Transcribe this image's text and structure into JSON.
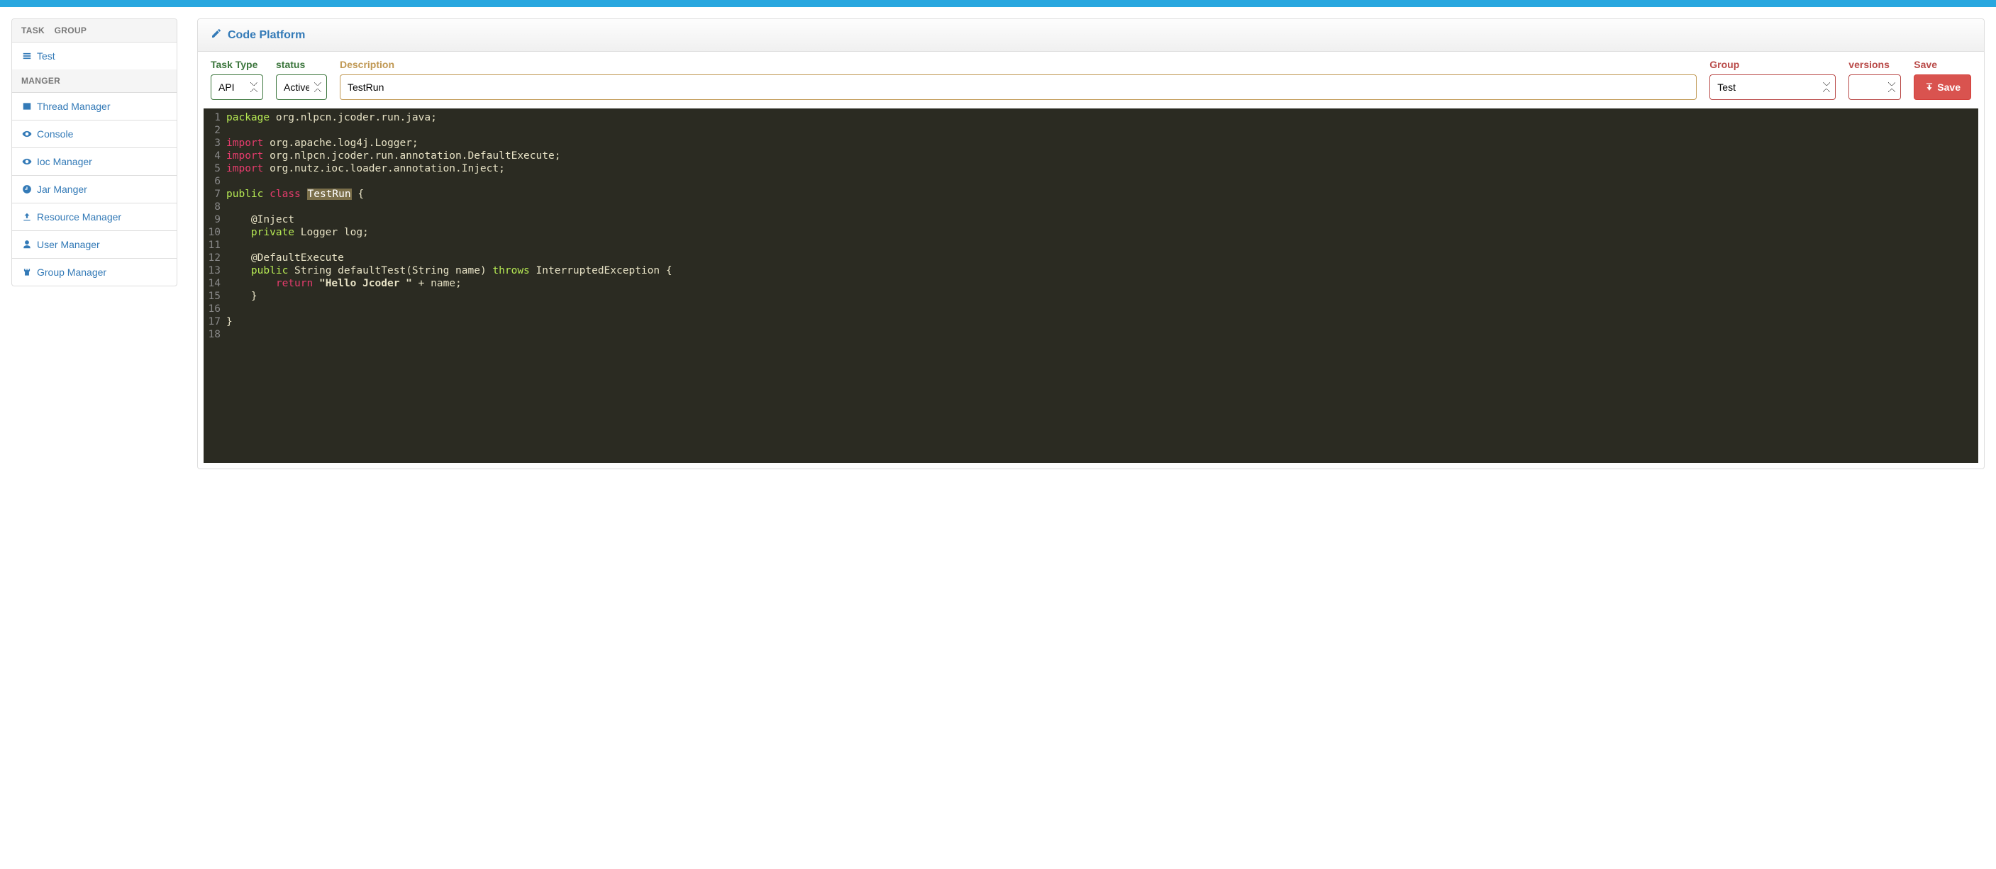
{
  "sidebar": {
    "headers": {
      "task": "TASK",
      "group": "GROUP",
      "manger": "MANGER"
    },
    "task_items": [
      {
        "id": "test",
        "label": "Test",
        "icon": "tasks-icon"
      }
    ],
    "manger_items": [
      {
        "id": "thread-manager",
        "label": "Thread Manager",
        "icon": "list-alt-icon"
      },
      {
        "id": "console",
        "label": "Console",
        "icon": "eye-icon"
      },
      {
        "id": "ioc-manager",
        "label": "Ioc Manager",
        "icon": "eye-icon"
      },
      {
        "id": "jar-manger",
        "label": "Jar Manger",
        "icon": "clock-icon"
      },
      {
        "id": "resource-manager",
        "label": "Resource Manager",
        "icon": "upload-icon"
      },
      {
        "id": "user-manager",
        "label": "User Manager",
        "icon": "user-icon"
      },
      {
        "id": "group-manager",
        "label": "Group Manager",
        "icon": "tower-icon"
      }
    ]
  },
  "header": {
    "title": "Code Platform"
  },
  "form": {
    "task_type": {
      "label": "Task Type",
      "value": "API",
      "options": [
        "API"
      ]
    },
    "status": {
      "label": "status",
      "value": "Active",
      "options": [
        "Active"
      ]
    },
    "description": {
      "label": "Description",
      "value": "TestRun"
    },
    "group": {
      "label": "Group",
      "value": "Test",
      "options": [
        "Test"
      ]
    },
    "versions": {
      "label": "versions",
      "value": "",
      "options": []
    },
    "save": {
      "label": "Save",
      "button": "Save"
    }
  },
  "code": {
    "lines": [
      {
        "n": 1,
        "segments": [
          {
            "t": "package",
            "c": "kw"
          },
          {
            "t": " ",
            "c": "punc"
          },
          {
            "t": "org.nlpcn.jcoder.run.java",
            "c": "type"
          },
          {
            "t": ";",
            "c": "punc"
          }
        ]
      },
      {
        "n": 2,
        "segments": []
      },
      {
        "n": 3,
        "segments": [
          {
            "t": "import",
            "c": "kw2"
          },
          {
            "t": " ",
            "c": "punc"
          },
          {
            "t": "org.apache.log4j.Logger",
            "c": "type"
          },
          {
            "t": ";",
            "c": "punc"
          }
        ]
      },
      {
        "n": 4,
        "segments": [
          {
            "t": "import",
            "c": "kw2"
          },
          {
            "t": " ",
            "c": "punc"
          },
          {
            "t": "org.nlpcn.jcoder.run.annotation.DefaultExecute",
            "c": "type"
          },
          {
            "t": ";",
            "c": "punc"
          }
        ]
      },
      {
        "n": 5,
        "segments": [
          {
            "t": "import",
            "c": "kw2"
          },
          {
            "t": " ",
            "c": "punc"
          },
          {
            "t": "org.nutz.ioc.loader.annotation.Inject",
            "c": "type"
          },
          {
            "t": ";",
            "c": "punc"
          }
        ]
      },
      {
        "n": 6,
        "segments": []
      },
      {
        "n": 7,
        "segments": [
          {
            "t": "public",
            "c": "kw"
          },
          {
            "t": " ",
            "c": "punc"
          },
          {
            "t": "class",
            "c": "kw2"
          },
          {
            "t": " ",
            "c": "punc"
          },
          {
            "t": "TestRun",
            "c": "hl"
          },
          {
            "t": " {",
            "c": "punc"
          }
        ]
      },
      {
        "n": 8,
        "segments": []
      },
      {
        "n": 9,
        "segments": [
          {
            "t": "    @Inject",
            "c": "ann"
          }
        ]
      },
      {
        "n": 10,
        "segments": [
          {
            "t": "    ",
            "c": "punc"
          },
          {
            "t": "private",
            "c": "kw"
          },
          {
            "t": " Logger log;",
            "c": "type"
          }
        ]
      },
      {
        "n": 11,
        "segments": []
      },
      {
        "n": 12,
        "segments": [
          {
            "t": "    @DefaultExecute",
            "c": "ann"
          }
        ]
      },
      {
        "n": 13,
        "segments": [
          {
            "t": "    ",
            "c": "punc"
          },
          {
            "t": "public",
            "c": "kw"
          },
          {
            "t": " String ",
            "c": "type"
          },
          {
            "t": "defaultTest",
            "c": "type"
          },
          {
            "t": "(String name) ",
            "c": "type"
          },
          {
            "t": "throws",
            "c": "kw"
          },
          {
            "t": " InterruptedException {",
            "c": "type"
          }
        ]
      },
      {
        "n": 14,
        "segments": [
          {
            "t": "        ",
            "c": "punc"
          },
          {
            "t": "return",
            "c": "kw2"
          },
          {
            "t": " ",
            "c": "punc"
          },
          {
            "t": "\"Hello Jcoder \"",
            "c": "str"
          },
          {
            "t": " + name;",
            "c": "type"
          }
        ]
      },
      {
        "n": 15,
        "segments": [
          {
            "t": "    }",
            "c": "punc"
          }
        ]
      },
      {
        "n": 16,
        "segments": []
      },
      {
        "n": 17,
        "segments": [
          {
            "t": "}",
            "c": "punc"
          }
        ]
      },
      {
        "n": 18,
        "segments": []
      }
    ]
  }
}
